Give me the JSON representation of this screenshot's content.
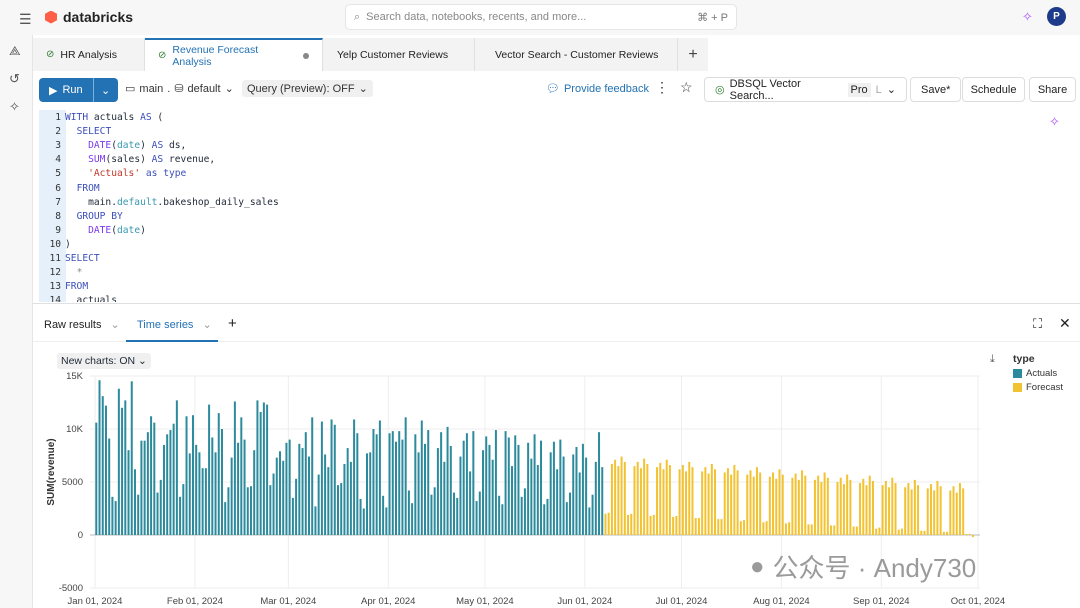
{
  "app": {
    "brand": "databricks",
    "search_placeholder": "Search data, notebooks, recents, and more...",
    "search_shortcut": "⌘ + P",
    "avatar": "P"
  },
  "tabs": [
    {
      "label": "HR Analysis",
      "status": "ok"
    },
    {
      "label": "Revenue Forecast Analysis",
      "status": "ok",
      "active": true,
      "unsaved": true
    },
    {
      "label": "Yelp Customer Reviews"
    },
    {
      "label": "Vector Search - Customer Reviews"
    }
  ],
  "toolbar": {
    "run": "Run",
    "catalog": "main",
    "schema": "default",
    "query_preview": "Query (Preview): OFF",
    "feedback": "Provide feedback",
    "warehouse": "DBSQL Vector Search...",
    "warehouse_tier": "Pro",
    "warehouse_size": "L",
    "save": "Save*",
    "schedule": "Schedule",
    "share": "Share"
  },
  "code": [
    "WITH actuals AS (",
    "  SELECT",
    "    DATE(date) AS ds,",
    "    SUM(sales) AS revenue,",
    "    'Actuals' as type",
    "  FROM",
    "    main.default.bakeshop_daily_sales",
    "  GROUP BY",
    "    DATE(date)",
    ")",
    "SELECT",
    "  *",
    "FROM",
    "  actuals"
  ],
  "results": {
    "tabs": [
      "Raw results",
      "Time series"
    ],
    "active": "Time series",
    "new_charts": "New charts: ON"
  },
  "watermark": "公众号 · Andy730",
  "colors": {
    "accent": "#2272b4",
    "actuals": "#2b8a9b",
    "forecast": "#f2c230"
  },
  "chart_data": {
    "type": "bar",
    "ylabel": "SUM(revenue)",
    "ylim": [
      -5000,
      15000
    ],
    "yticks": [
      "15K",
      "10K",
      "5000",
      "0",
      "-5000"
    ],
    "xticks": [
      "Jan 01, 2024",
      "Feb 01, 2024",
      "Mar 01, 2024",
      "Apr 01, 2024",
      "May 01, 2024",
      "Jun 01, 2024",
      "Jul 01, 2024",
      "Aug 01, 2024",
      "Sep 01, 2024",
      "Oct 01, 2024"
    ],
    "grid": true,
    "legend": {
      "title": "type",
      "placement": "top-right"
    },
    "frequency": "daily",
    "series": [
      {
        "name": "Actuals",
        "start": "2024-01-01",
        "values": [
          10600,
          14600,
          13100,
          12200,
          9100,
          3600,
          3200,
          13800,
          12000,
          12700,
          8000,
          14500,
          6200,
          3800,
          8900,
          8900,
          9700,
          11200,
          10600,
          4000,
          5200,
          8500,
          9500,
          9900,
          10500,
          12700,
          3600,
          4800,
          11200,
          7700,
          11300,
          8500,
          7800,
          6300,
          6300,
          12300,
          9200,
          7800,
          11500,
          10000,
          3100,
          4500,
          7300,
          12600,
          8700,
          11100,
          9000,
          4500,
          4600,
          8000,
          12700,
          11600,
          12500,
          12300,
          4700,
          5800,
          7300,
          7900,
          7000,
          8700,
          9000,
          3500,
          5300,
          8600,
          8200,
          9700,
          7400,
          11100,
          2700,
          5700,
          10700,
          7600,
          6400,
          10900,
          10400,
          4700,
          4900,
          6700,
          8200,
          6900,
          10900,
          9600,
          3400,
          2500,
          7700,
          7800,
          10000,
          9500,
          10800,
          3700,
          2600,
          9600,
          9800,
          8800,
          9800,
          9000,
          11100,
          4200,
          3000,
          9500,
          7800,
          10800,
          8600,
          9900,
          3800,
          4500,
          8200,
          9700,
          6900,
          10200,
          8400,
          4000,
          3500,
          7400,
          8900,
          9600,
          6000,
          9800,
          3200,
          4100,
          8000,
          9300,
          8500,
          7100,
          9900,
          3700,
          2900,
          9800,
          9200,
          6500,
          9400,
          8500,
          3600,
          4400,
          8700,
          7200,
          9500,
          6600,
          8900,
          2900,
          3400,
          7800,
          8800,
          6200,
          9000,
          7400,
          3100,
          4000,
          7600,
          8300,
          5900,
          8600,
          7300,
          2600,
          3800,
          6900,
          9700,
          6400
        ]
      },
      {
        "name": "Forecast",
        "start": "2024-06-07",
        "values": [
          2000,
          2100,
          6700,
          7100,
          6500,
          7400,
          6900,
          1900,
          2000,
          6500,
          6900,
          6300,
          7200,
          6700,
          1800,
          1900,
          6400,
          6800,
          6200,
          7100,
          6600,
          1700,
          1800,
          6200,
          6600,
          6000,
          6900,
          6400,
          1600,
          1600,
          6000,
          6400,
          5800,
          6700,
          6200,
          1500,
          1500,
          5900,
          6300,
          5700,
          6600,
          6100,
          1300,
          1400,
          5700,
          6100,
          5500,
          6400,
          5900,
          1200,
          1300,
          5500,
          5900,
          5300,
          6200,
          5700,
          1100,
          1200,
          5400,
          5800,
          5200,
          6100,
          5600,
          1000,
          1000,
          5200,
          5600,
          5000,
          5900,
          5400,
          900,
          900,
          5000,
          5400,
          4800,
          5700,
          5200,
          800,
          800,
          4900,
          5300,
          4700,
          5600,
          5100,
          600,
          700,
          4700,
          5100,
          4500,
          5400,
          4900,
          500,
          600,
          4500,
          4900,
          4300,
          5200,
          4700,
          400,
          400,
          4400,
          4800,
          4200,
          5100,
          4600,
          300,
          300,
          4200,
          4600,
          4000,
          4900,
          4400,
          100,
          100,
          -200
        ]
      }
    ]
  }
}
